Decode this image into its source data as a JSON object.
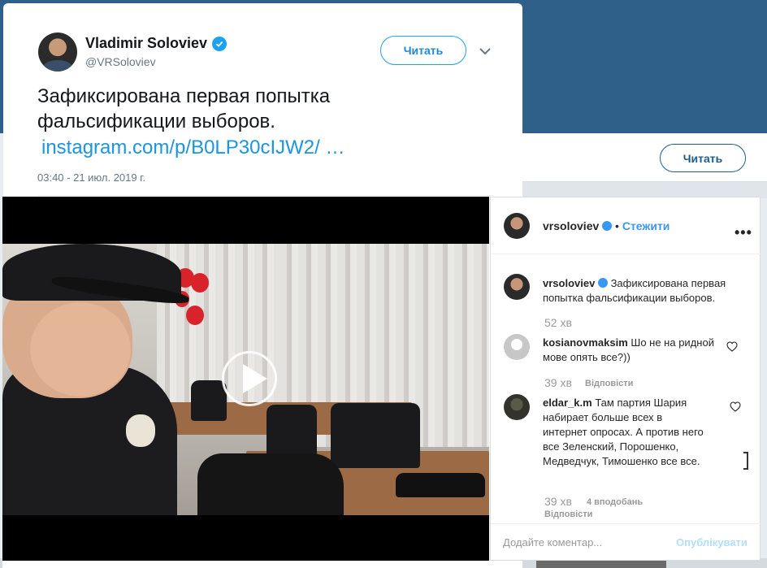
{
  "background": {
    "follow_label": "Читать"
  },
  "tweet": {
    "user_name": "Vladimir Soloviev",
    "handle": "@VRSoloviev",
    "follow_label": "Читать",
    "text": "Зафиксирована первая попытка фальсификации выборов.",
    "link": "instagram.com/p/B0LP30cIJW2/ …",
    "timestamp": "03:40 - 21 июл. 2019 г."
  },
  "instagram": {
    "username": "vrsoloviev",
    "follow_label": "Стежити",
    "more_label": "•••",
    "post": {
      "username": "vrsoloviev",
      "caption": "Зафиксирована первая попытка фальсификации выборов.",
      "time": "52 хв"
    },
    "comments": [
      {
        "username": "kosianovmaksim",
        "text": "Шо не на ридной мове опять все?))",
        "time": "39 хв",
        "reply_label": "Відповісти"
      },
      {
        "username": "eldar_k.m",
        "text": "Там партия Шария набирает больше всех в интернет опросах. А против него все Зеленский, Порошенко, Медведчук, Тимошенко все все.",
        "time": "39 хв",
        "likes": "4 вподобань",
        "reply_label": "Відповісти"
      }
    ],
    "comment_placeholder": "Додайте коментар...",
    "post_label": "Опублікувати"
  },
  "colors": {
    "twitter_blue": "#1da1f2",
    "link_blue": "#1b95e0",
    "instagram_blue": "#3897f0",
    "header_bg": "#2e6089"
  }
}
